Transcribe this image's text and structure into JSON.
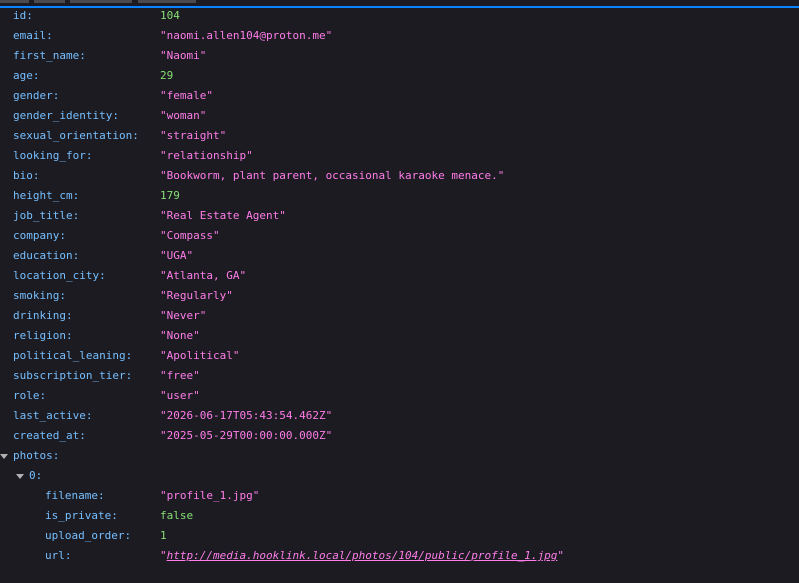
{
  "fields": [
    {
      "key": "id:",
      "value": "104",
      "type": "num"
    },
    {
      "key": "email:",
      "value": "\"naomi.allen104@proton.me\"",
      "type": "str"
    },
    {
      "key": "first_name:",
      "value": "\"Naomi\"",
      "type": "str"
    },
    {
      "key": "age:",
      "value": "29",
      "type": "num"
    },
    {
      "key": "gender:",
      "value": "\"female\"",
      "type": "str"
    },
    {
      "key": "gender_identity:",
      "value": "\"woman\"",
      "type": "str"
    },
    {
      "key": "sexual_orientation:",
      "value": "\"straight\"",
      "type": "str"
    },
    {
      "key": "looking_for:",
      "value": "\"relationship\"",
      "type": "str"
    },
    {
      "key": "bio:",
      "value": "\"Bookworm, plant parent, occasional karaoke menace.\"",
      "type": "str"
    },
    {
      "key": "height_cm:",
      "value": "179",
      "type": "num"
    },
    {
      "key": "job_title:",
      "value": "\"Real Estate Agent\"",
      "type": "str"
    },
    {
      "key": "company:",
      "value": "\"Compass\"",
      "type": "str"
    },
    {
      "key": "education:",
      "value": "\"UGA\"",
      "type": "str"
    },
    {
      "key": "location_city:",
      "value": "\"Atlanta, GA\"",
      "type": "str"
    },
    {
      "key": "smoking:",
      "value": "\"Regularly\"",
      "type": "str"
    },
    {
      "key": "drinking:",
      "value": "\"Never\"",
      "type": "str"
    },
    {
      "key": "religion:",
      "value": "\"None\"",
      "type": "str"
    },
    {
      "key": "political_leaning:",
      "value": "\"Apolitical\"",
      "type": "str"
    },
    {
      "key": "subscription_tier:",
      "value": "\"free\"",
      "type": "str"
    },
    {
      "key": "role:",
      "value": "\"user\"",
      "type": "str"
    },
    {
      "key": "last_active:",
      "value": "\"2026-06-17T05:43:54.462Z\"",
      "type": "str"
    },
    {
      "key": "created_at:",
      "value": "\"2025-05-29T00:00:00.000Z\"",
      "type": "str"
    }
  ],
  "photos": {
    "key": "photos:",
    "item_key": "0:",
    "filename": {
      "key": "filename:",
      "value": "\"profile_1.jpg\""
    },
    "is_private": {
      "key": "is_private:",
      "value": "false"
    },
    "upload_order": {
      "key": "upload_order:",
      "value": "1"
    },
    "url": {
      "key": "url:",
      "quote": "\"",
      "link": "http://media.hooklink.local/photos/104/public/profile_1.jpg"
    }
  },
  "colors": {
    "key": "#75bfff",
    "string": "#ff7de9",
    "number": "#86de74",
    "background": "#1c1b22",
    "accent": "#0a84ff"
  }
}
